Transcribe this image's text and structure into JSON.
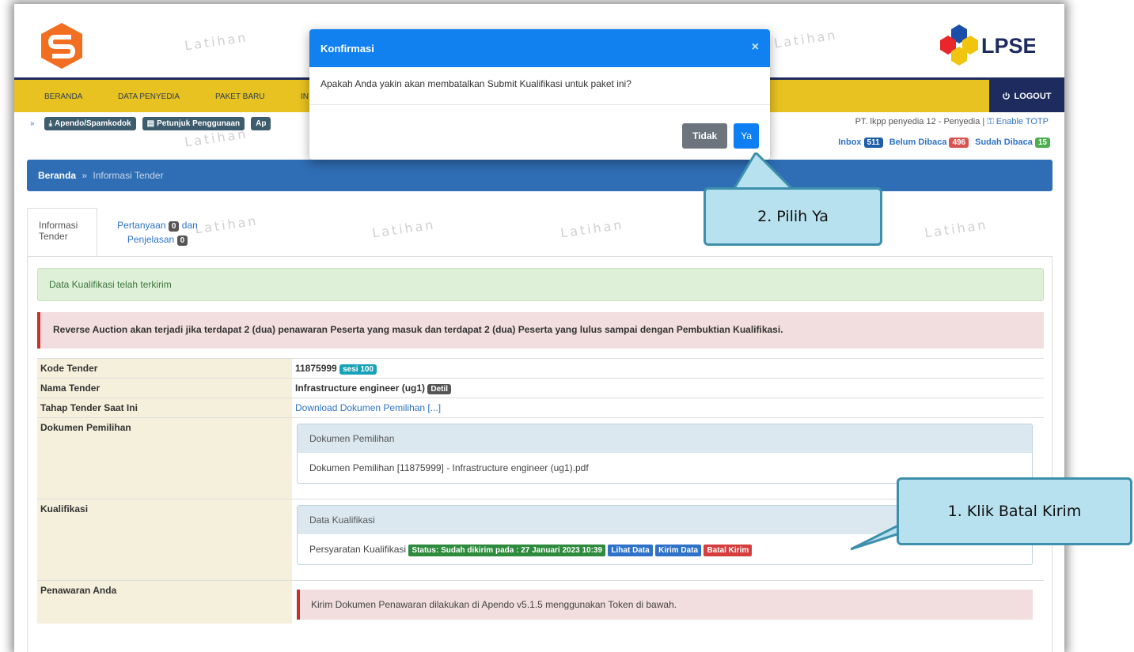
{
  "watermark": "Latihan",
  "header": {
    "lpse_logo_text": "LPSE"
  },
  "nav": {
    "items": [
      "BERANDA",
      "DATA PENYEDIA",
      "PAKET BARU",
      "IN"
    ],
    "logout": "LOGOUT"
  },
  "toolbar": {
    "apendo": "Apendo/Spamkodok",
    "petunjuk": "Petunjuk Penggunaan",
    "cut": "Ap"
  },
  "user": {
    "name": "PT. lkpp penyedia 12 - Penyedia |",
    "totp": "Enable TOTP"
  },
  "messages": {
    "inbox_label": "Inbox",
    "inbox_count": "511",
    "unread_label": "Belum Dibaca",
    "unread_count": "496",
    "read_label": "Sudah Dibaca",
    "read_count": "15"
  },
  "breadcrumb": {
    "home": "Beranda",
    "sep": "»",
    "current": "Informasi Tender"
  },
  "tabs": {
    "active_line1": "Informasi",
    "active_line2": "Tender",
    "other_line1": "Pertanyaan",
    "other_badge1": "0",
    "other_mid": "dan",
    "other_line2": "Penjelasan",
    "other_badge2": "0"
  },
  "alerts": {
    "success": "Data Kualifikasi telah terkirim",
    "warning": "Reverse Auction akan terjadi jika terdapat 2 (dua) penawaran Peserta yang masuk dan terdapat 2 (dua) Peserta yang lulus sampai dengan Pembuktian Kualifikasi."
  },
  "table": {
    "kode_label": "Kode Tender",
    "kode_value": "11875999",
    "kode_sesi": "sesi 100",
    "nama_label": "Nama Tender",
    "nama_value": "Infrastructure engineer (ug1)",
    "nama_detil": "Detil",
    "tahap_label": "Tahap Tender Saat Ini",
    "tahap_value": "Download Dokumen Pemilihan [...]",
    "dok_label": "Dokumen Pemilihan",
    "dok_panel_head": "Dokumen Pemilihan",
    "dok_panel_body": "Dokumen Pemilihan [11875999] - Infrastructure engineer (ug1).pdf",
    "kual_label": "Kualifikasi",
    "kual_panel_head": "Data Kualifikasi",
    "kual_persyaratan": "Persyaratan Kualifikasi",
    "kual_status": "Status: Sudah dikirim pada : 27 Januari 2023 10:39",
    "kual_lihat": "Lihat Data",
    "kual_kirim": "Kirim Data",
    "kual_batal": "Batal Kirim",
    "penawaran_label": "Penawaran Anda",
    "penawaran_note": "Kirim Dokumen Penawaran dilakukan di Apendo v5.1.5 menggunakan Token di bawah."
  },
  "modal": {
    "title": "Konfirmasi",
    "close": "×",
    "message": "Apakah Anda yakin akan membatalkan Submit Kualifikasi untuk paket ini?",
    "cancel": "Tidak",
    "confirm": "Ya"
  },
  "callouts": {
    "step2": "2. Pilih Ya",
    "step1": "1. Klik Batal Kirim"
  }
}
